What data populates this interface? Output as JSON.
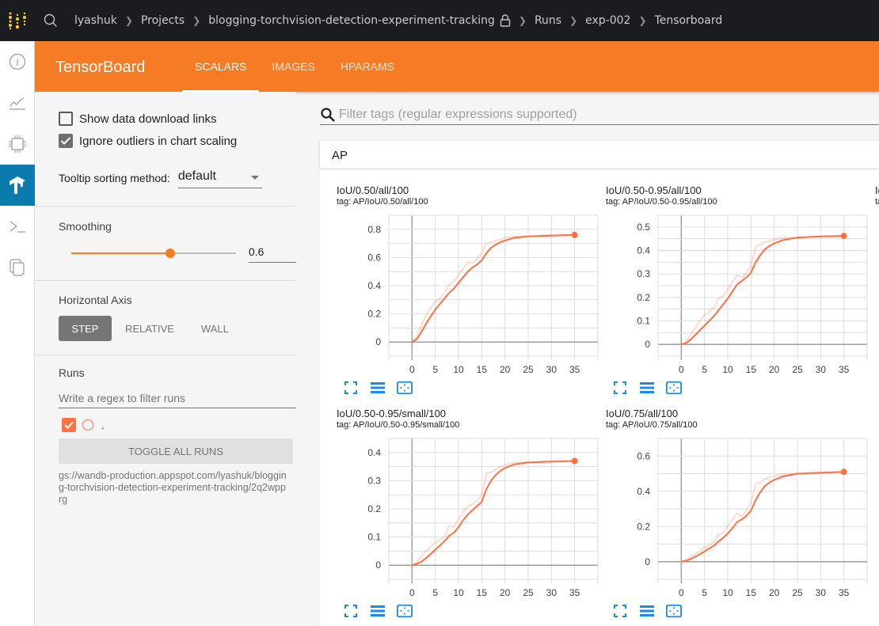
{
  "topbar": {
    "breadcrumbs": [
      "lyashuk",
      "Projects",
      "blogging-torchvision-detection-experiment-tracking",
      "Runs",
      "exp-002",
      "Tensorboard"
    ],
    "icons": [
      "wandb-logo-icon",
      "search-icon",
      "lock-icon",
      "chevron-right-icon"
    ]
  },
  "rail": {
    "items": [
      {
        "icon": "info-icon"
      },
      {
        "icon": "chart-line-icon"
      },
      {
        "icon": "chip-icon"
      },
      {
        "icon": "tensorflow-icon",
        "active": true
      },
      {
        "icon": "terminal-icon"
      },
      {
        "icon": "files-icon"
      }
    ]
  },
  "header": {
    "title": "TensorBoard",
    "tabs": [
      {
        "label": "SCALARS",
        "active": true
      },
      {
        "label": "IMAGES",
        "active": false
      },
      {
        "label": "HPARAMS",
        "active": false
      }
    ],
    "accent_color": "#f57c24"
  },
  "sidebar": {
    "show_download_links": {
      "label": "Show data download links",
      "checked": false
    },
    "ignore_outliers": {
      "label": "Ignore outliers in chart scaling",
      "checked": true
    },
    "tooltip_sorting": {
      "label": "Tooltip sorting method:",
      "value": "default"
    },
    "smoothing": {
      "label": "Smoothing",
      "value": "0.6",
      "fraction": 0.6
    },
    "horizontal_axis": {
      "label": "Horizontal Axis",
      "options": [
        "STEP",
        "RELATIVE",
        "WALL"
      ],
      "selected": "STEP"
    },
    "runs": {
      "label": "Runs",
      "filter_placeholder": "Write a regex to filter runs",
      "items": [
        {
          "name": ".",
          "checked": true,
          "color": "#ff7043"
        }
      ],
      "toggle_all_label": "TOGGLE ALL RUNS",
      "path": "gs://wandb-production.appspot.com/lyashuk/blogging-torchvision-detection-experiment-tracking/2q2wpprg"
    }
  },
  "main": {
    "filter_placeholder": "Filter tags (regular expressions supported)",
    "group_title": "AP",
    "partial_card_title": "Io",
    "partial_card_tag": "ta"
  },
  "chart_data": [
    {
      "type": "line",
      "title": "IoU/0.50/all/100",
      "tag": "tag: AP/IoU/0.50/all/100",
      "xlabel": "",
      "ylabel": "",
      "xlim": [
        -5,
        40
      ],
      "ylim": [
        -0.1,
        0.9
      ],
      "xticks": [
        0,
        5,
        10,
        15,
        20,
        25,
        30,
        35
      ],
      "yticks": [
        0,
        0.2,
        0.4,
        0.6,
        0.8
      ],
      "ytick_labels": [
        "0",
        "0.2",
        "0.4",
        "0.6",
        "0.8"
      ],
      "series": [
        {
          "name": "raw",
          "x": [
            0,
            1,
            2,
            3,
            4,
            5,
            6,
            7,
            8,
            9,
            10,
            11,
            12,
            13,
            14,
            15,
            16,
            17,
            18,
            19,
            20,
            22,
            25,
            30,
            35
          ],
          "values": [
            0,
            0.04,
            0.12,
            0.19,
            0.24,
            0.29,
            0.31,
            0.35,
            0.41,
            0.43,
            0.48,
            0.52,
            0.57,
            0.56,
            0.59,
            0.63,
            0.7,
            0.71,
            0.72,
            0.73,
            0.74,
            0.75,
            0.75,
            0.76,
            0.76
          ]
        },
        {
          "name": ".",
          "x": [
            0,
            1,
            2,
            3,
            4,
            5,
            6,
            7,
            8,
            9,
            10,
            11,
            12,
            13,
            14,
            15,
            16,
            17,
            18,
            19,
            20,
            22,
            25,
            30,
            35
          ],
          "values": [
            0,
            0.02,
            0.07,
            0.13,
            0.18,
            0.23,
            0.27,
            0.31,
            0.35,
            0.38,
            0.42,
            0.46,
            0.5,
            0.53,
            0.55,
            0.58,
            0.63,
            0.67,
            0.69,
            0.71,
            0.72,
            0.74,
            0.75,
            0.755,
            0.76
          ]
        }
      ]
    },
    {
      "type": "line",
      "title": "IoU/0.50-0.95/all/100",
      "tag": "tag: AP/IoU/0.50-0.95/all/100",
      "xlabel": "",
      "ylabel": "",
      "xlim": [
        -5,
        40
      ],
      "ylim": [
        -0.05,
        0.55
      ],
      "xticks": [
        0,
        5,
        10,
        15,
        20,
        25,
        30,
        35
      ],
      "yticks": [
        0,
        0.1,
        0.2,
        0.3,
        0.4,
        0.5
      ],
      "ytick_labels": [
        "0",
        "0.1",
        "0.2",
        "0.3",
        "0.4",
        "0.5"
      ],
      "series": [
        {
          "name": "raw",
          "x": [
            0,
            1,
            2,
            3,
            4,
            5,
            6,
            7,
            8,
            9,
            10,
            11,
            12,
            13,
            14,
            15,
            16,
            17,
            18,
            19,
            20,
            22,
            25,
            30,
            35
          ],
          "values": [
            0,
            0.01,
            0.04,
            0.07,
            0.1,
            0.125,
            0.14,
            0.155,
            0.195,
            0.205,
            0.235,
            0.265,
            0.295,
            0.285,
            0.305,
            0.335,
            0.415,
            0.425,
            0.435,
            0.44,
            0.445,
            0.455,
            0.455,
            0.46,
            0.46
          ]
        },
        {
          "name": ".",
          "x": [
            0,
            1,
            2,
            3,
            4,
            5,
            6,
            7,
            8,
            9,
            10,
            11,
            12,
            13,
            14,
            15,
            16,
            17,
            18,
            19,
            20,
            22,
            25,
            30,
            35
          ],
          "values": [
            0,
            0.005,
            0.02,
            0.04,
            0.06,
            0.08,
            0.1,
            0.12,
            0.145,
            0.17,
            0.195,
            0.225,
            0.255,
            0.27,
            0.285,
            0.305,
            0.35,
            0.38,
            0.405,
            0.42,
            0.43,
            0.445,
            0.455,
            0.46,
            0.462
          ]
        }
      ]
    },
    {
      "type": "line",
      "title": "IoU/0.50-0.95/small/100",
      "tag": "tag: AP/IoU/0.50-0.95/small/100",
      "xlabel": "",
      "ylabel": "",
      "xlim": [
        -5,
        40
      ],
      "ylim": [
        -0.05,
        0.45
      ],
      "xticks": [
        0,
        5,
        10,
        15,
        20,
        25,
        30,
        35
      ],
      "yticks": [
        0,
        0.1,
        0.2,
        0.3,
        0.4
      ],
      "ytick_labels": [
        "0",
        "0.1",
        "0.2",
        "0.3",
        "0.4"
      ],
      "series": [
        {
          "name": "raw",
          "x": [
            0,
            1,
            2,
            3,
            4,
            5,
            6,
            7,
            8,
            9,
            10,
            11,
            12,
            13,
            14,
            15,
            16,
            17,
            18,
            19,
            20,
            22,
            25,
            30,
            35
          ],
          "values": [
            0,
            0.01,
            0.03,
            0.05,
            0.065,
            0.08,
            0.09,
            0.1,
            0.14,
            0.135,
            0.165,
            0.19,
            0.21,
            0.215,
            0.23,
            0.25,
            0.325,
            0.33,
            0.34,
            0.35,
            0.355,
            0.365,
            0.365,
            0.368,
            0.37
          ]
        },
        {
          "name": ".",
          "x": [
            0,
            1,
            2,
            3,
            4,
            5,
            6,
            7,
            8,
            9,
            10,
            11,
            12,
            13,
            14,
            15,
            16,
            17,
            18,
            19,
            20,
            22,
            25,
            30,
            35
          ],
          "values": [
            0,
            0.005,
            0.012,
            0.025,
            0.04,
            0.055,
            0.07,
            0.085,
            0.105,
            0.115,
            0.135,
            0.16,
            0.18,
            0.195,
            0.21,
            0.225,
            0.27,
            0.3,
            0.32,
            0.335,
            0.345,
            0.358,
            0.365,
            0.368,
            0.37
          ]
        }
      ]
    },
    {
      "type": "line",
      "title": "IoU/0.75/all/100",
      "tag": "tag: AP/IoU/0.75/all/100",
      "xlabel": "",
      "ylabel": "",
      "xlim": [
        -5,
        40
      ],
      "ylim": [
        -0.1,
        0.7
      ],
      "xticks": [
        0,
        5,
        10,
        15,
        20,
        25,
        30,
        35
      ],
      "yticks": [
        0,
        0.2,
        0.4,
        0.6
      ],
      "ytick_labels": [
        "0",
        "0.2",
        "0.4",
        "0.6"
      ],
      "series": [
        {
          "name": "raw",
          "x": [
            0,
            1,
            2,
            3,
            4,
            5,
            6,
            7,
            8,
            9,
            10,
            11,
            12,
            13,
            14,
            15,
            16,
            17,
            18,
            19,
            20,
            22,
            25,
            30,
            35
          ],
          "values": [
            0,
            0.01,
            0.03,
            0.045,
            0.06,
            0.08,
            0.095,
            0.11,
            0.155,
            0.165,
            0.2,
            0.24,
            0.275,
            0.26,
            0.29,
            0.33,
            0.44,
            0.45,
            0.47,
            0.48,
            0.485,
            0.495,
            0.5,
            0.505,
            0.51
          ]
        },
        {
          "name": ".",
          "x": [
            0,
            1,
            2,
            3,
            4,
            5,
            6,
            7,
            8,
            9,
            10,
            11,
            12,
            13,
            14,
            15,
            16,
            17,
            18,
            19,
            20,
            22,
            25,
            30,
            35
          ],
          "values": [
            0,
            0.005,
            0.015,
            0.028,
            0.042,
            0.058,
            0.075,
            0.09,
            0.115,
            0.135,
            0.16,
            0.19,
            0.225,
            0.24,
            0.26,
            0.29,
            0.35,
            0.395,
            0.43,
            0.45,
            0.465,
            0.485,
            0.5,
            0.505,
            0.51
          ]
        }
      ]
    }
  ]
}
